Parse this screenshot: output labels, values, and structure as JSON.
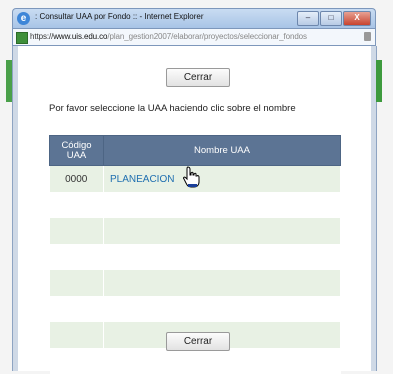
{
  "window": {
    "title": ": Consultar UAA por Fondo :: - Internet Explorer",
    "minimize_label": "–",
    "maximize_label": "□",
    "close_label": "X"
  },
  "address": {
    "protocol": "https://",
    "domain": "www.uis.edu.co",
    "path": "/plan_gestion2007/elaborar/proyectos/seleccionar_fondos"
  },
  "page": {
    "close_top": "Cerrar",
    "close_bottom": "Cerrar",
    "instructions": "Por favor seleccione la UAA haciendo clic sobre el nombre"
  },
  "table": {
    "headers": [
      "Código UAA",
      "Nombre UAA"
    ],
    "rows": [
      {
        "code": "0000",
        "name": "PLANEACION"
      },
      {
        "code": "",
        "name": ""
      },
      {
        "code": "",
        "name": ""
      },
      {
        "code": "",
        "name": ""
      },
      {
        "code": "",
        "name": ""
      },
      {
        "code": "",
        "name": ""
      },
      {
        "code": "",
        "name": ""
      },
      {
        "code": "",
        "name": ""
      }
    ]
  },
  "icons": {
    "browser": "internet-explorer-icon",
    "page": "page-icon",
    "lock": "lock-icon",
    "cursor": "hand-cursor-icon"
  }
}
